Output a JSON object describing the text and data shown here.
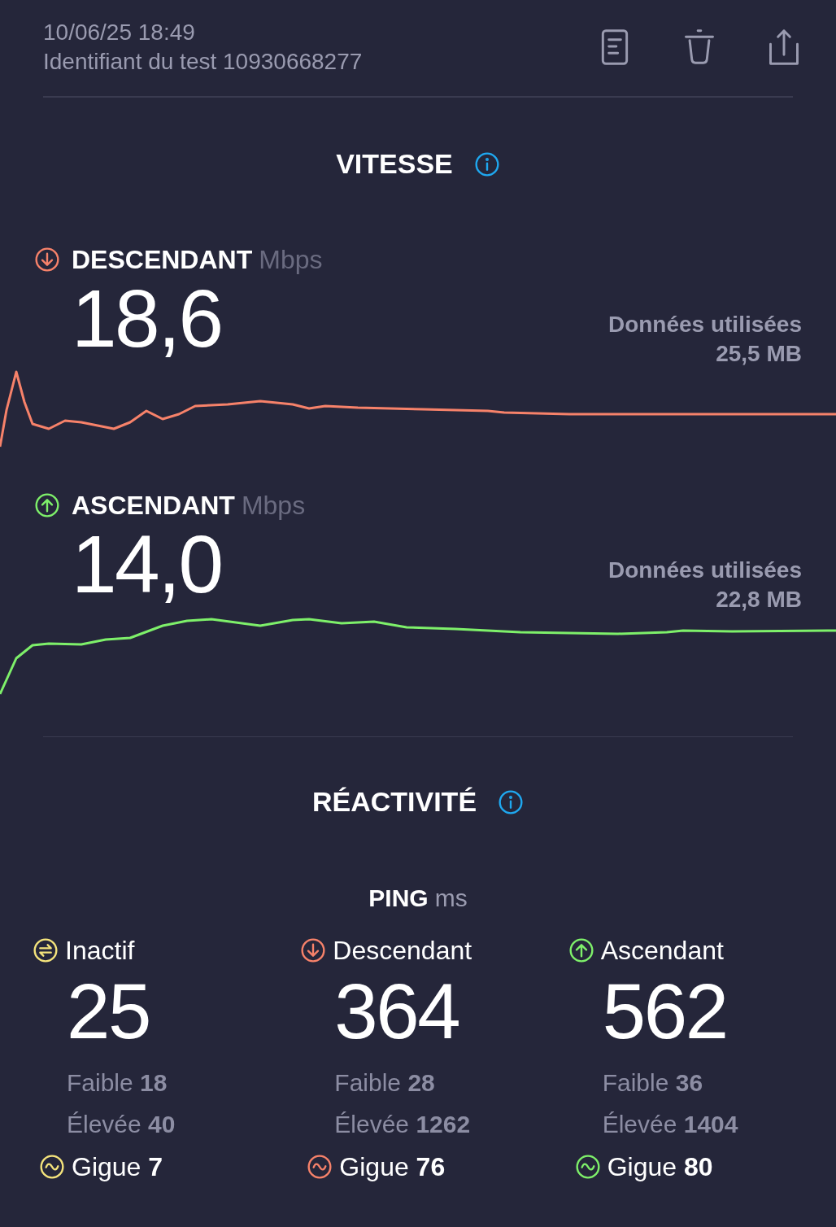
{
  "header": {
    "datetime": "10/06/25 18:49",
    "test_id": "Identifiant du test 10930668277"
  },
  "speed": {
    "title": "VITESSE",
    "tests": [
      {
        "kind": "down",
        "color": "#f7826a",
        "label": "DESCENDANT",
        "unit": "Mbps",
        "value": "18,6",
        "data_label": "Données utilisées",
        "data_value": "25,5 MB"
      },
      {
        "kind": "up",
        "color": "#7ef06a",
        "label": "ASCENDANT",
        "unit": "Mbps",
        "value": "14,0",
        "data_label": "Données utilisées",
        "data_value": "22,8 MB"
      }
    ]
  },
  "responsiveness": {
    "title": "RÉACTIVITÉ",
    "ping_label": "PING",
    "ping_unit": "ms",
    "columns": [
      {
        "kind": "idle",
        "color": "#f5e47c",
        "label": "Inactif",
        "value": "25",
        "low": "Faible **18**",
        "high": "Élevée **40**",
        "jitter": "Gigue **7**"
      },
      {
        "kind": "down",
        "color": "#f7826a",
        "label": "Descendant",
        "value": "364",
        "low": "Faible **28**",
        "high": "Élevée **1262**",
        "jitter": "Gigue **76**"
      },
      {
        "kind": "up",
        "color": "#7ef06a",
        "label": "Ascendant",
        "value": "562",
        "low": "Faible **36**",
        "high": "Élevée **1404**",
        "jitter": "Gigue **80**"
      }
    ]
  }
}
